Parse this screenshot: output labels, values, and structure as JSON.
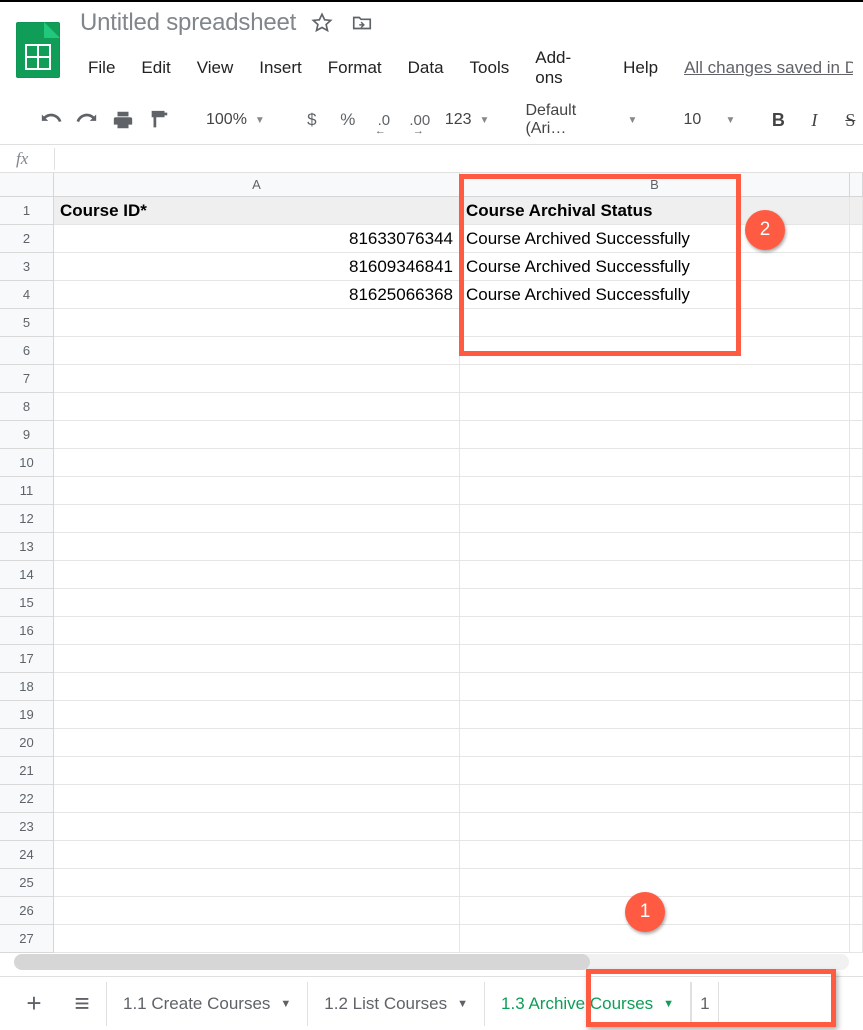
{
  "header": {
    "title": "Untitled spreadsheet",
    "star_icon": "star-outline",
    "folder_icon": "move-folder",
    "saved_status": "All changes saved in D"
  },
  "menus": [
    "File",
    "Edit",
    "View",
    "Insert",
    "Format",
    "Data",
    "Tools",
    "Add-ons",
    "Help"
  ],
  "toolbar": {
    "zoom": "100%",
    "currency_symbol": "$",
    "percent_symbol": "%",
    "dec_less": ".0",
    "dec_more": ".00",
    "num_fmt": "123",
    "font": "Default (Ari…",
    "font_size": "10",
    "bold_label": "B",
    "italic_label": "I",
    "strike_label": "S"
  },
  "formula_bar": {
    "fx_label": "fx",
    "value": ""
  },
  "columns": {
    "A": "A",
    "B": "B",
    "C": ""
  },
  "sheet": {
    "header_row": {
      "A": "Course ID*",
      "B": "Course Archival Status"
    },
    "rows": [
      {
        "A": "81633076344",
        "B": "Course Archived Successfully"
      },
      {
        "A": "81609346841",
        "B": "Course Archived Successfully"
      },
      {
        "A": "81625066368",
        "B": "Course Archived Successfully"
      }
    ],
    "total_rows_visible": 27
  },
  "sheet_tabs": {
    "tabs": [
      {
        "label": "1.1 Create Courses",
        "active": false
      },
      {
        "label": "1.2 List Courses",
        "active": false
      },
      {
        "label": "1.3 Archive Courses",
        "active": true
      }
    ],
    "partial_next": "1"
  },
  "annotations": {
    "badge1": "1",
    "badge2": "2"
  }
}
